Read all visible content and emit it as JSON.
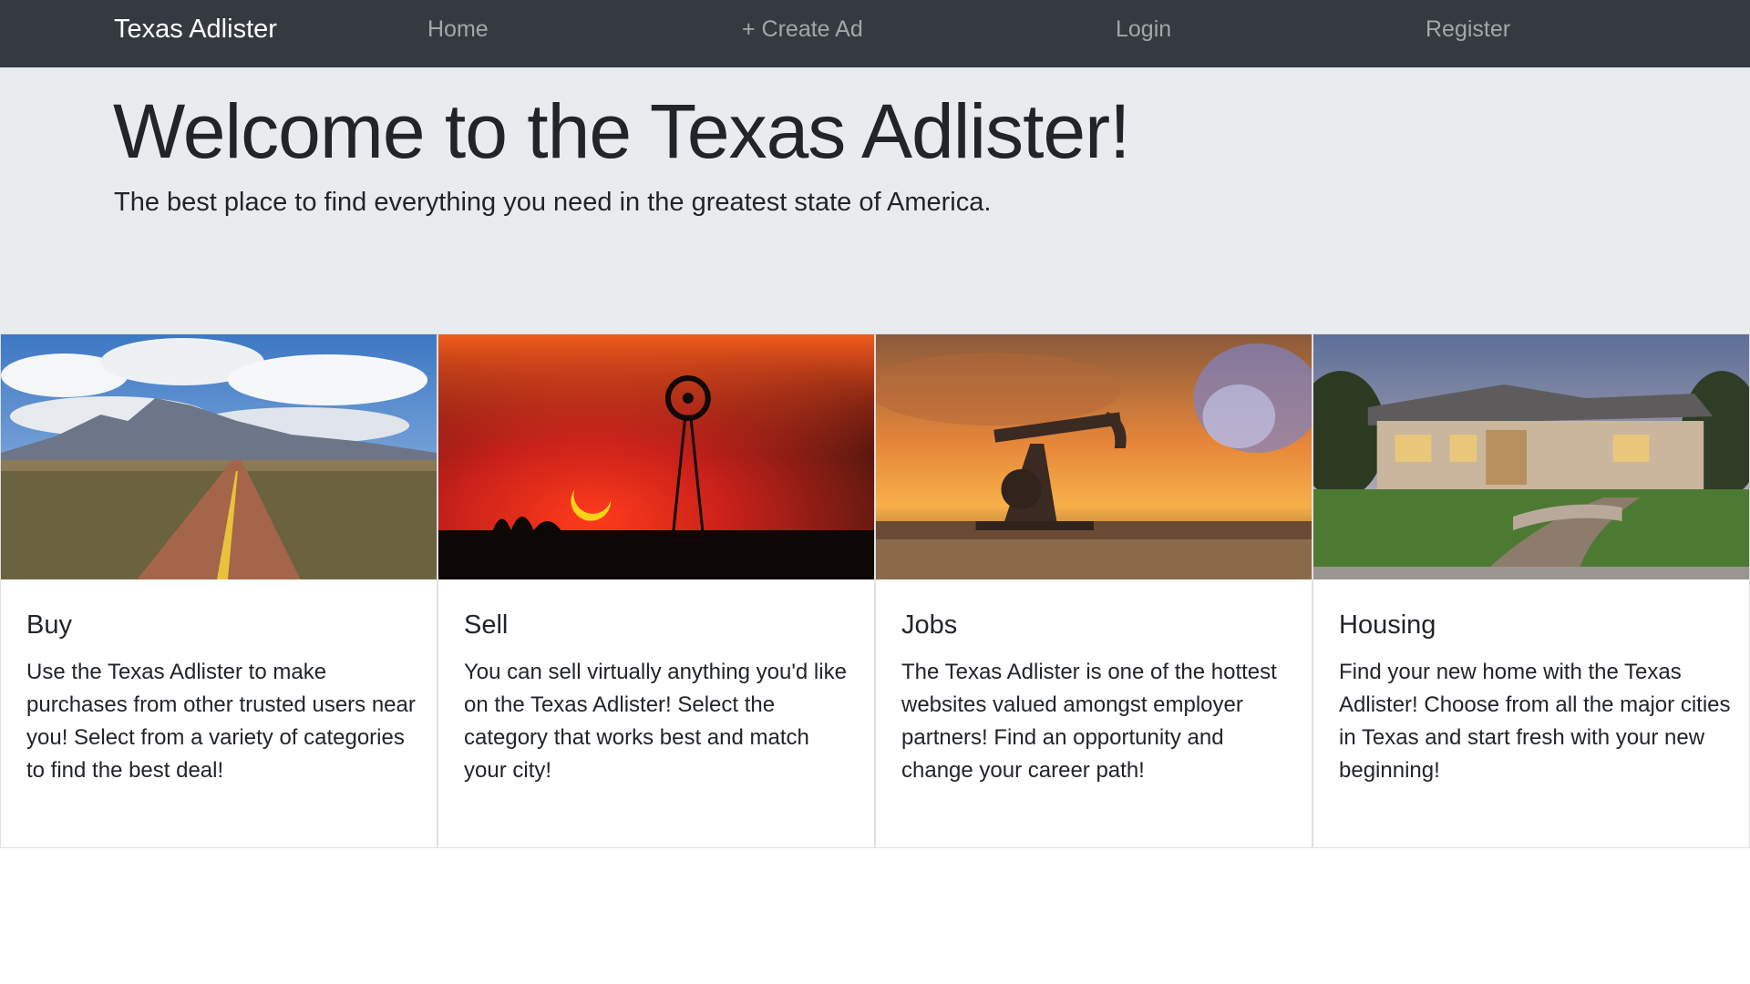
{
  "navbar": {
    "brand": "Texas Adlister",
    "links": [
      "Home",
      "+ Create Ad",
      "Login",
      "Register"
    ]
  },
  "jumbotron": {
    "title": "Welcome to the Texas Adlister!",
    "lead": "The best place to find everything you need in the greatest state of America."
  },
  "cards": [
    {
      "title": "Buy",
      "text": "Use the Texas Adlister to make purchases from other trusted users near you! Select from a variety of categories to find the best deal!",
      "image_icon": "desert-road-image"
    },
    {
      "title": "Sell",
      "text": "You can sell virtually anything you'd like on the Texas Adlister! Select the category that works best and match your city!",
      "image_icon": "windmill-sunset-image"
    },
    {
      "title": "Jobs",
      "text": "The Texas Adlister is one of the hottest websites valued amongst employer partners! Find an opportunity and change your career path!",
      "image_icon": "oil-pump-image"
    },
    {
      "title": "Housing",
      "text": "Find your new home with the Texas Adlister! Choose from all the major cities in Texas and start fresh with your new beginning!",
      "image_icon": "house-image"
    }
  ],
  "colors": {
    "navbar_bg": "#343a40",
    "jumbotron_bg": "#e9ecef",
    "text": "#212529"
  }
}
